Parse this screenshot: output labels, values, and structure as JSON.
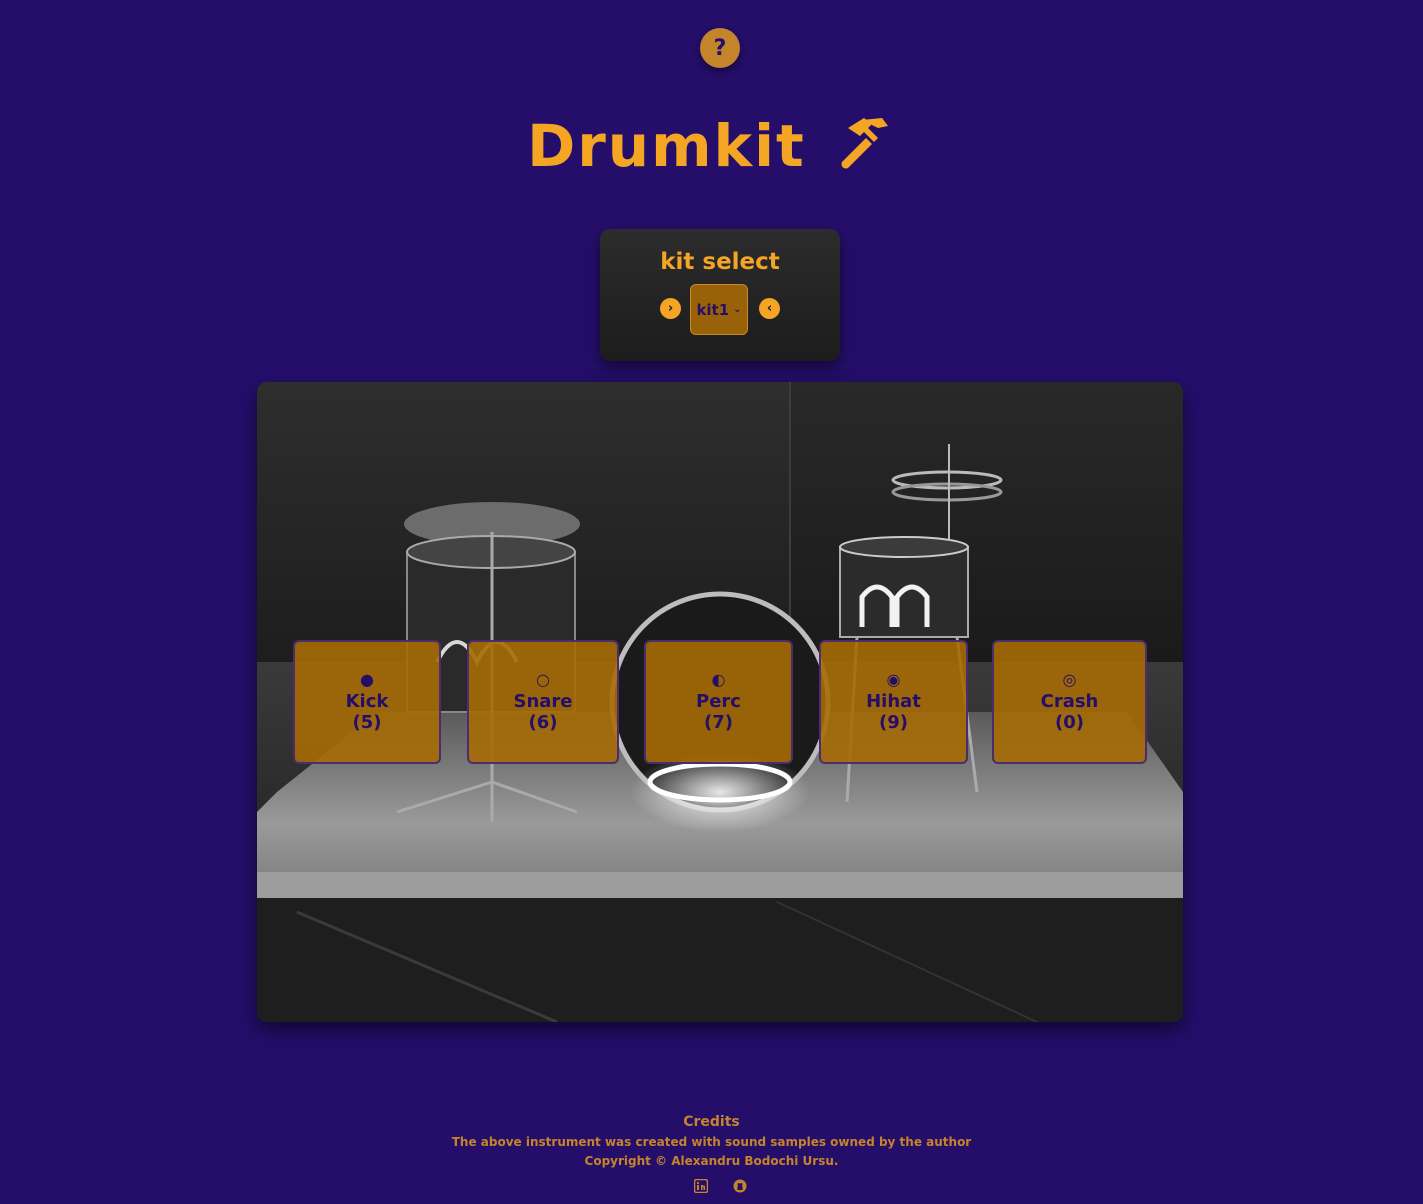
{
  "help": {
    "icon": "question-icon",
    "label": "?"
  },
  "header": {
    "title": "Drumkit",
    "icon": "hammer-icon"
  },
  "kit_select": {
    "label": "kit select",
    "value": "kit1",
    "next_icon": "chevron-right-icon",
    "prev_icon": "chevron-left-icon"
  },
  "pads": [
    {
      "name": "Kick",
      "key": "(5)",
      "icon": "filled-circle-icon",
      "glyph": "●"
    },
    {
      "name": "Snare",
      "key": "(6)",
      "icon": "empty-circle-icon",
      "glyph": "○"
    },
    {
      "name": "Perc",
      "key": "(7)",
      "icon": "half-circle-icon",
      "glyph": "◐"
    },
    {
      "name": "Hihat",
      "key": "(9)",
      "icon": "dot-circle-icon",
      "glyph": "◉"
    },
    {
      "name": "Crash",
      "key": "(0)",
      "icon": "bullseye-icon",
      "glyph": "◎"
    }
  ],
  "footer": {
    "credits_title": "Credits",
    "line1": "The above instrument was created with sound samples owned by the author",
    "line2": "Copyright © Alexandru Bodochi Ursu.",
    "links": [
      "linkedin-icon",
      "github-icon"
    ]
  },
  "colors": {
    "background": "#240e6a",
    "accent": "#f5a524",
    "pad": "#a66a04",
    "muted_accent": "#c4842c"
  }
}
